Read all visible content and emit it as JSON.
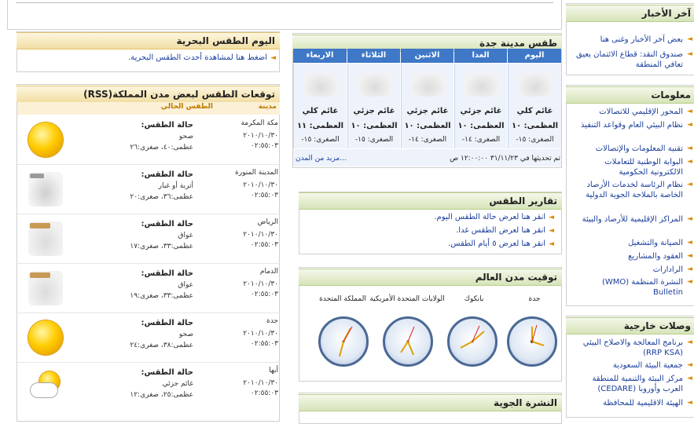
{
  "latest_news": {
    "title": "آخر الأخبار",
    "items": [
      "بعض آخر الأخبار وغنى هنا",
      "صندوق النقد: قطاع الائتمان يعيق تعافي المنطقة"
    ]
  },
  "sea_weather": {
    "title": "اليوم الطقس البحرية",
    "link": "اضغط هنا لمشاهدة أحدث الطقس البحرية."
  },
  "city_forecast": {
    "title": "طقس مدينة جدة",
    "days": [
      {
        "name": "اليوم",
        "condition": "غائم كلي",
        "max": "العظمى: ١٠",
        "min": "الصغرى: ١٥-"
      },
      {
        "name": "الغدا",
        "condition": "غائم جزئي",
        "max": "العظمى: ١٠",
        "min": "الصغرى: ١٤-"
      },
      {
        "name": "الاثنين",
        "condition": "غائم جزئي",
        "max": "العظمى: ١٠",
        "min": "الصغرى: ١٤-"
      },
      {
        "name": "الثلاثاء",
        "condition": "غائم جزئي",
        "max": "العظمى: ١٠",
        "min": "الصغرى: ١٥-"
      },
      {
        "name": "الاربعاء",
        "condition": "غائم كلي",
        "max": "العظمى: ١١",
        "min": "الصغرى: ١٥-"
      }
    ],
    "updated": "تم تحديثها في ٣١/١١/٢٣ ١٢:٠٠:٠٠ ص",
    "more": "مزيد من المدن..."
  },
  "rss": {
    "title": "توقعات الطقس لبعض مدن المملكة(RSS)",
    "col_city": "مدينة",
    "col_weather": "الطقس الحالي",
    "rows": [
      {
        "city": "مكة المكرمة",
        "date": "٢٠١٠/١٠/٣٠",
        "time": "٠٢:٥٥:٠٣",
        "label": "حالة الطقس:",
        "condition": "صحو",
        "temps": "عظمى:٤٠، صغرى:٢٦",
        "icon": "sun-icon"
      },
      {
        "city": "المدينة المنورة",
        "date": "٢٠١٠/١٠/٣٠",
        "time": "٠٢:٥٥:٠٣",
        "label": "حالة الطقس:",
        "condition": "أتربة أو غبار",
        "temps": "عظمى:٣٦، صغرى:٢٠",
        "icon": "dust-icon"
      },
      {
        "city": "الرياض",
        "date": "٢٠١٠/١٠/٣٠",
        "time": "٠٢:٥٥:٠٣",
        "label": "حالة الطقس:",
        "condition": "عواق",
        "temps": "عظمى:٣٣، صغرى:١٧",
        "icon": "haze-icon"
      },
      {
        "city": "الدمام",
        "date": "٢٠١٠/١٠/٣٠",
        "time": "٠٢:٥٥:٠٣",
        "label": "حالة الطقس:",
        "condition": "عواق",
        "temps": "عظمى:٣٣، صغرى:١٩",
        "icon": "haze-icon"
      },
      {
        "city": "جدة",
        "date": "٢٠١٠/١٠/٣٠",
        "time": "٠٢:٥٥:٠٣",
        "label": "حالة الطقس:",
        "condition": "صحو",
        "temps": "عظمى:٣٨، صغرى:٢٤",
        "icon": "sun-icon"
      },
      {
        "city": "أبها",
        "date": "٢٠١٠/١٠/٣٠",
        "time": "٠٢:٥٥:٠٣",
        "label": "حالة الطقس:",
        "condition": "غائم جزئي",
        "temps": "عظمى:٢٥، صغرى:١٢",
        "icon": "partly-cloudy-icon"
      }
    ]
  },
  "reports": {
    "title": "تقارير الطقس",
    "links": [
      "انقر هنا لعرض حالة الطقس اليوم.",
      "انقر هنا لعرض الطقس غدا.",
      "انقر هنا لعرض ٥ أيام الطقس."
    ]
  },
  "world_clocks": {
    "title": "توقيت مدن العالم",
    "cities": [
      "جدة",
      "بانكوك",
      "الولايات المتحدة الأمريكية",
      "المملكة المتحدة"
    ]
  },
  "bulletin": {
    "title": "النشرة الجوية"
  },
  "info": {
    "title": "معلومات",
    "items": [
      "المحور الإقليمي للاتصالات",
      "نظام البيئي العام وقواعد التنفيذ",
      "تقنية المعلومات والإتصالات",
      "البوابة الوطنية للتعاملات الالكترونية الحكومية",
      "نظام الرئاسة لخدمات الأرصاد الخاصة بالملاحة الجوية الدولية",
      "المراكز الإقليمية للأرصاد والبيئة",
      "الصيانة والتشغيل",
      "العقود والمشاريع",
      "الرادارات",
      "النشرة المنظمة (WMO) Bulletin"
    ]
  },
  "external_links": {
    "title": "وصلات خارجية",
    "items": [
      "برنامج المعالجة والاصلاح البيئي (RRP KSA)",
      "جمعية البيئة السعودية",
      "مركز البيئة والتنمية للمنطقة العرب وأوروبا (CEDARE)",
      "الهيئة الاقليمية للمحافظة"
    ]
  }
}
